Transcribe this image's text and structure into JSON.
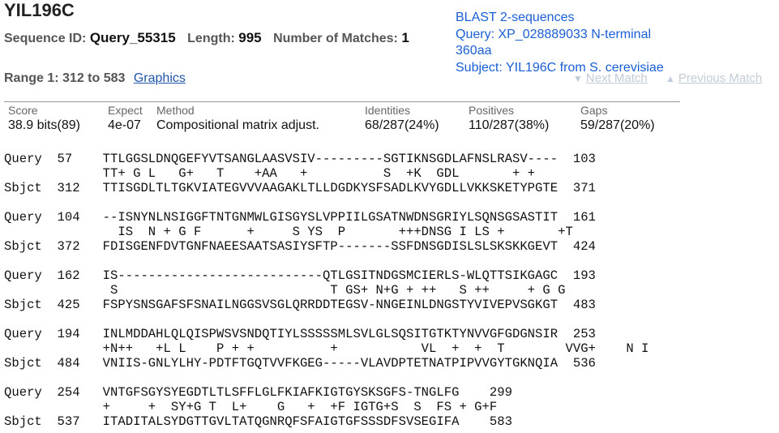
{
  "title": "YIL196C",
  "sequence": {
    "id_label": "Sequence ID:",
    "id_value": "Query_55315",
    "length_label": "Length:",
    "length_value": "995",
    "matches_label": "Number of Matches:",
    "matches_value": "1"
  },
  "range": {
    "text": "Range 1: 312 to 583",
    "graphics_link": "Graphics"
  },
  "blast_info": [
    "BLAST 2-sequences",
    "Query: XP_028889033 N-terminal",
    "360aa",
    "Subject: YIL196C from S. cerevisiae"
  ],
  "nav": {
    "next": "Next Match",
    "previous": "Previous Match"
  },
  "stats": {
    "score": {
      "label": "Score",
      "value": "38.9 bits(89)"
    },
    "expect": {
      "label": "Expect",
      "value": "4e-07"
    },
    "method": {
      "label": "Method",
      "value": "Compositional matrix adjust."
    },
    "identities": {
      "label": "Identities",
      "value": "68/287(24%)"
    },
    "positives": {
      "label": "Positives",
      "value": "110/287(38%)"
    },
    "gaps": {
      "label": "Gaps",
      "value": "59/287(20%)"
    }
  },
  "alignment": [
    {
      "query": "Query  57    TTLGGSLDNQGEFYVTSANGLAASVSIV---------SGTIKNSGDLAFNSLRASV----  103",
      "match": "             TT+ G L   G+   T    +AA   +          S  +K  GDL       + +",
      "sbjct": "Sbjct  312   TTISGDLTLTGKVIATEGVVVAAGAKLTLLDGDKYSFSADLKVYGDLLVKKSKETYPGTE  371"
    },
    {
      "query": "Query  104   --ISNYNLNSIGGFTNTGNMWLGISGYSLVPPIILGSATNWDNSGRIYLSQNSGSASTIT  161",
      "match": "               IS  N + G F      +     S YS  P       +++DNSG I LS +       +T",
      "sbjct": "Sbjct  372   FDISGENFDVTGNFNAEESAATSASIYSFTP-------SSFDNSGDISLSLSKSKKGEVT  424"
    },
    {
      "query": "Query  162   IS---------------------------QTLGSITNDGSMCIERLS-WLQTTSIKGAGC  193",
      "match": "              S                            T GS+ N+G + ++   S ++     + G G",
      "sbjct": "Sbjct  425   FSPYSNSGAFSFSNAILNGGSVSGLQRRDDTEGSV-NNGEINLDNGSTYVIVEPVSGKGT  483"
    },
    {
      "query": "Query  194   INLMDDAHLQLQISPWSVSNDQTIYLSSSSSMLSVLGLSQSITGTKTYNVVGFGDGNSIR  253",
      "match": "             +N++   +L L    P + +          +           VL  +  +  T        VVG+    N I",
      "sbjct": "Sbjct  484   VNIIS-GNLYLHY-PDTFTGQTVVFKGEG-----VLAVDPTETNATPIPVVGYTGKNQIA  536"
    },
    {
      "query": "Query  254   VNTGFSGYSYEGDTLTLSFFLGLFKIAFKIGTGYSKSGFS-TNGLFG    299",
      "match": "             +     +  SY+G T  L+    G   +  +F IGTG+S  S  FS + G+F",
      "sbjct": "Sbjct  537   ITADITALSYDGTTGVLTATQGNRQFSFAIGTGFSSSDFSVSEGIFA    583"
    }
  ]
}
